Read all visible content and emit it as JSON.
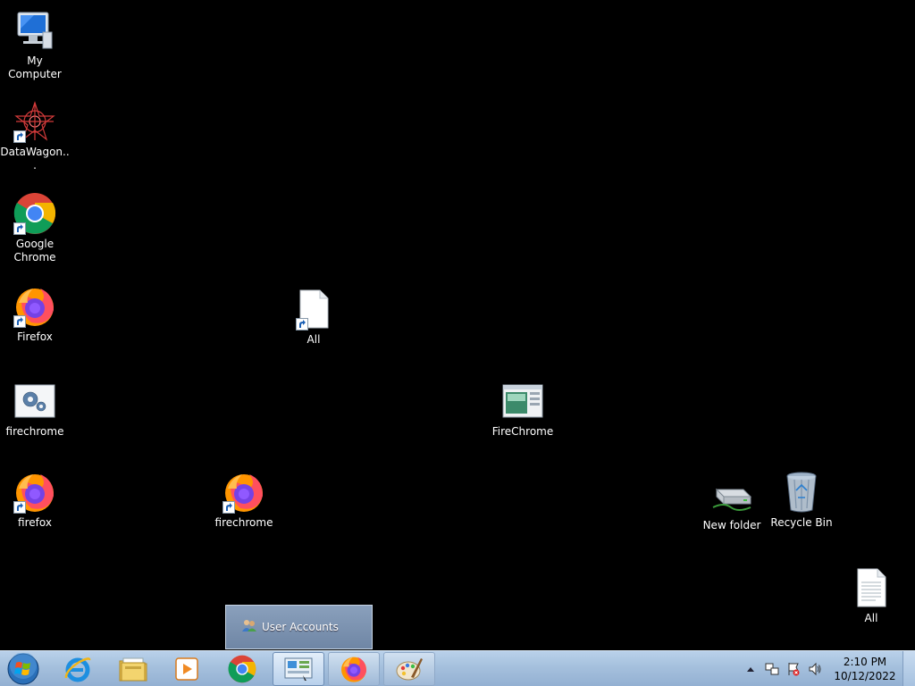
{
  "desktop": {
    "icons": [
      {
        "label": "My Computer",
        "icon": "computer-icon"
      },
      {
        "label": "DataWagon...",
        "icon": "datawagon-icon",
        "shortcut": true
      },
      {
        "label": "Google Chrome",
        "icon": "chrome-icon",
        "shortcut": true
      },
      {
        "label": "Firefox",
        "icon": "firefox-icon",
        "shortcut": true
      },
      {
        "label": "firechrome",
        "icon": "settings-file-icon"
      },
      {
        "label": "firefox",
        "icon": "firefox-icon",
        "shortcut": true
      },
      {
        "label": "All",
        "icon": "blank-file-icon",
        "shortcut": true
      },
      {
        "label": "firechrome",
        "icon": "firefox-icon",
        "shortcut": true
      },
      {
        "label": "FireChrome",
        "icon": "window-app-icon"
      },
      {
        "label": "New folder",
        "icon": "drive-icon"
      },
      {
        "label": "Recycle Bin",
        "icon": "recycle-bin-icon"
      },
      {
        "label": "All",
        "icon": "text-file-icon"
      }
    ]
  },
  "popup": {
    "label": "User Accounts",
    "icon": "users-icon"
  },
  "taskbar": {
    "buttons": [
      {
        "name": "internet-explorer",
        "icon": "ie-icon"
      },
      {
        "name": "file-explorer",
        "icon": "folder-icon"
      },
      {
        "name": "media-player",
        "icon": "media-player-icon"
      },
      {
        "name": "chrome",
        "icon": "chrome-icon"
      },
      {
        "name": "control-panel",
        "icon": "control-panel-icon",
        "state": "active"
      },
      {
        "name": "firefox",
        "icon": "firefox-icon",
        "state": "open"
      },
      {
        "name": "paint",
        "icon": "paint-icon",
        "state": "open"
      }
    ],
    "clock": {
      "time": "2:10 PM",
      "date": "10/12/2022"
    }
  },
  "colors": {
    "desktop": "#000000",
    "taskbar": "#a5c0dd",
    "label": "#ffffff"
  }
}
